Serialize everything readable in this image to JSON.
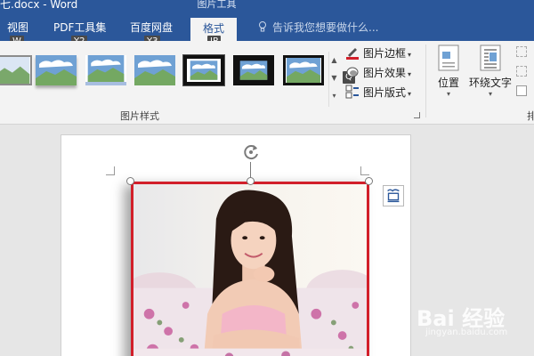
{
  "window": {
    "title": "七.docx - Word"
  },
  "context_tab_header": "图片工具",
  "tabs": [
    {
      "label": "视图",
      "keytip": "W"
    },
    {
      "label": "PDF工具集",
      "keytip": "Y2"
    },
    {
      "label": "百度网盘",
      "keytip": "Y3"
    },
    {
      "label": "格式",
      "keytip": "JP",
      "active": true
    }
  ],
  "tell_me": {
    "placeholder": "告诉我您想要做什么..."
  },
  "ribbon": {
    "picture_styles": {
      "label": "图片样式",
      "thumbnails": [
        "style-1",
        "style-2",
        "style-3",
        "style-4",
        "style-5",
        "style-6",
        "style-7"
      ]
    },
    "keytip_q": "Q",
    "commands": {
      "border": "图片边框",
      "effects": "图片效果",
      "layout": "图片版式"
    },
    "arrange": {
      "position": "位置",
      "wrap_text": "环绕文字",
      "truncated_label": "排"
    }
  },
  "colors": {
    "accent": "#2b579a",
    "selection_border": "#d21f2a"
  },
  "watermark": {
    "brand": "Bai 经验",
    "sub": "jingyan.baidu.com"
  }
}
